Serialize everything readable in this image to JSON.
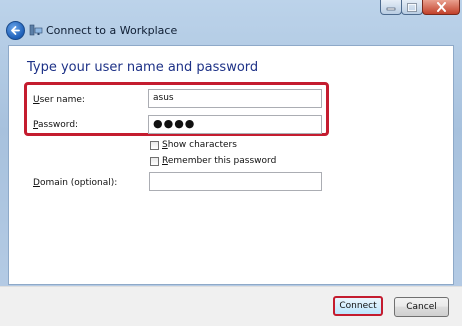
{
  "window": {
    "title": "Connect to a Workplace",
    "controls": {
      "minimize_icon": "minimize-icon",
      "maximize_icon": "maximize-icon",
      "close_icon": "close-icon"
    }
  },
  "nav": {
    "back_icon": "back-arrow-icon",
    "forward_icon": "forward-arrow-icon",
    "app_icon": "network-icon"
  },
  "content": {
    "heading": "Type your user name and password",
    "username": {
      "label_accel": "U",
      "label_rest": "ser name:",
      "value": "asus"
    },
    "password": {
      "label_accel": "P",
      "label_rest": "assword:",
      "value": "●●●●"
    },
    "show_characters": {
      "label_accel": "S",
      "label_rest": "how characters",
      "checked": false
    },
    "remember_password": {
      "label_accel": "R",
      "label_rest": "emember this password",
      "checked": false
    },
    "domain": {
      "label_accel": "D",
      "label_rest": "omain (optional):",
      "value": ""
    }
  },
  "footer": {
    "connect_label": "Connect",
    "cancel_label": "Cancel"
  },
  "colors": {
    "highlight": "#c41c2f",
    "heading": "#1e3287"
  }
}
